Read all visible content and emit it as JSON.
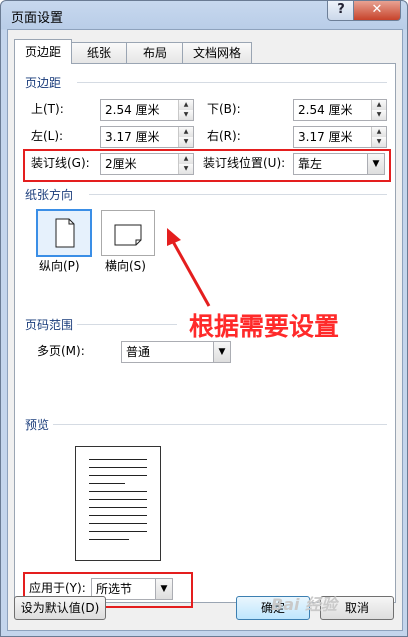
{
  "window": {
    "title": "页面设置",
    "help_glyph": "?",
    "close_glyph": "✕"
  },
  "tabs": [
    "页边距",
    "纸张",
    "布局",
    "文档网格"
  ],
  "margins": {
    "group": "页边距",
    "top": {
      "label": "上(T):",
      "value": "2.54 厘米"
    },
    "bottom": {
      "label": "下(B):",
      "value": "2.54 厘米"
    },
    "left": {
      "label": "左(L):",
      "value": "3.17 厘米"
    },
    "right": {
      "label": "右(R):",
      "value": "3.17 厘米"
    },
    "gutter": {
      "label": "装订线(G):",
      "value": "2厘米"
    },
    "gutter_pos": {
      "label": "装订线位置(U):",
      "value": "靠左"
    }
  },
  "orientation": {
    "group": "纸张方向",
    "portrait": "纵向(P)",
    "landscape": "横向(S)",
    "selected": "portrait"
  },
  "annotation": "根据需要设置",
  "pages": {
    "group": "页码范围",
    "label": "多页(M):",
    "value": "普通"
  },
  "preview": {
    "group": "预览"
  },
  "apply": {
    "label": "应用于(Y):",
    "value": "所选节"
  },
  "buttons": {
    "default": "设为默认值(D)",
    "ok": "确定",
    "cancel": "取消"
  },
  "watermark": "Bai 经验",
  "colors": {
    "annotation_red": "#e41e1e",
    "selection_blue": "#3a8ee6"
  }
}
